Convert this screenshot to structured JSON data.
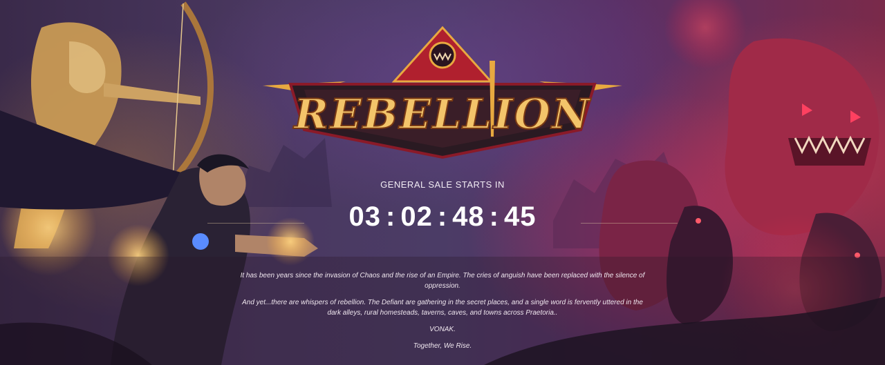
{
  "banner": {
    "logo_text": "REBELLION",
    "sale_label": "GENERAL SALE STARTS IN",
    "countdown": {
      "days": "03",
      "hours": "02",
      "minutes": "48",
      "seconds": "45",
      "separator": ":"
    },
    "story": [
      "It has been years since the invasion of Chaos and the rise of an Empire. The cries of anguish have been replaced with the silence of oppression.",
      "And yet...there are whispers of rebellion. The Defiant are gathering in the secret places, and a single word is fervently uttered in the dark alleys, rural homesteads, taverns, caves, and towns across Praetoria..",
      "VONAK.",
      "Together, We Rise."
    ]
  },
  "colors": {
    "logo_gold": "#f3c46a",
    "logo_red": "#a8142a",
    "background_purple": "#4a3860",
    "enemy_red": "#d8304a"
  }
}
